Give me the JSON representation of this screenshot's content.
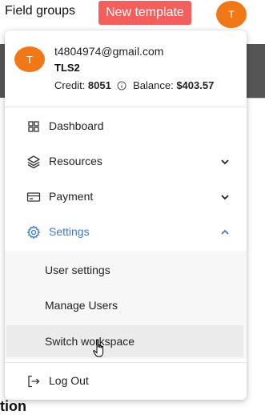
{
  "background": {
    "field_groups": "Field groups",
    "new_template_label": "New template",
    "avatar_initial": "T",
    "partial_heading": "tion"
  },
  "profile": {
    "avatar_initial": "T",
    "email": "t4804974@gmail.com",
    "workspace": "TLS2",
    "credit_label": "Credit:",
    "credit_value": "8051",
    "balance_label": "Balance:",
    "balance_value": "$403.57"
  },
  "menu": {
    "dashboard": "Dashboard",
    "resources": "Resources",
    "payment": "Payment",
    "settings": "Settings",
    "logout": "Log Out"
  },
  "settings_submenu": {
    "user_settings": "User settings",
    "manage_users": "Manage Users",
    "switch_workspace": "Switch workspace"
  },
  "colors": {
    "accent": "#3a7bd5",
    "avatar": "#f07816",
    "new_template_bg": "#f25f5c"
  }
}
